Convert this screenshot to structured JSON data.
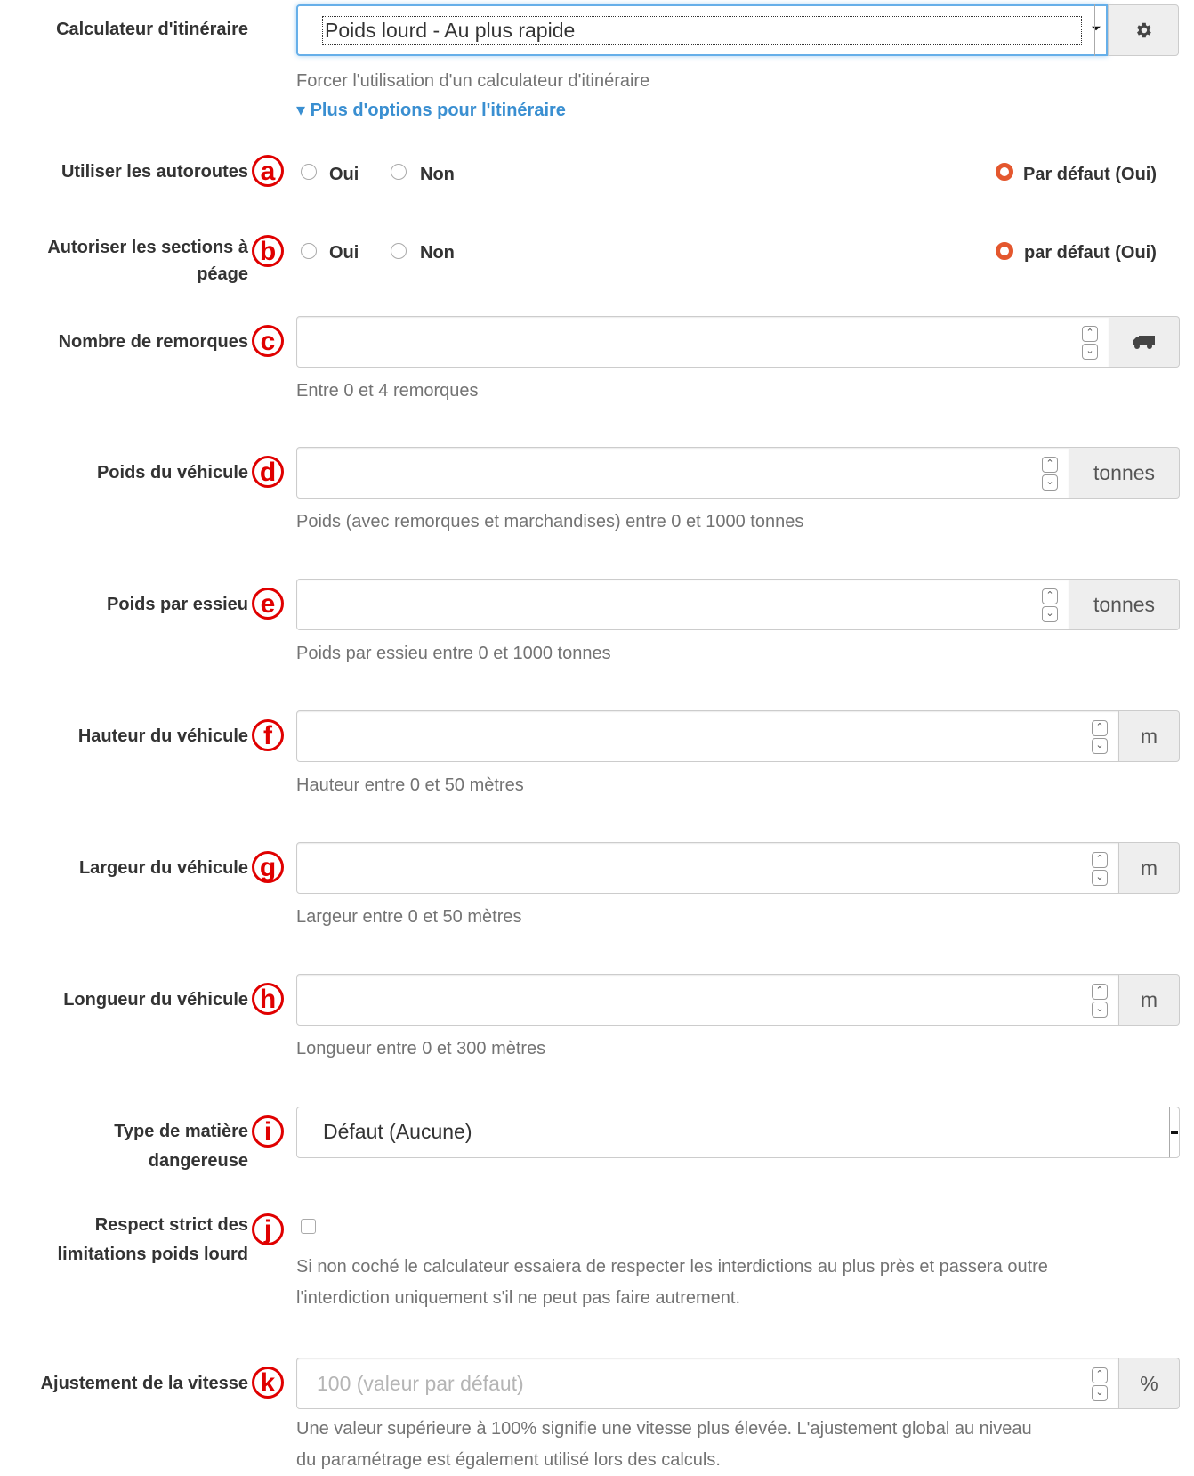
{
  "router": {
    "label": "Calculateur d'itinéraire",
    "selected": "Poids lourd - Au plus rapide",
    "help": "Forcer l'utilisation d'un calculateur d'itinéraire",
    "more_options": "▾ Plus d'options pour l'itinéraire"
  },
  "highways": {
    "label": "Utiliser les autoroutes",
    "badge": "a",
    "yes": "Oui",
    "no": "Non",
    "default": "Par défaut (Oui)"
  },
  "tolls": {
    "label_line1": "Autoriser les sections à",
    "label_line2": "péage",
    "badge": "b",
    "yes": "Oui",
    "no": "Non",
    "default": "par défaut (Oui)"
  },
  "trailers": {
    "label": "Nombre de remorques",
    "badge": "c",
    "help": "Entre 0 et 4 remorques"
  },
  "weight": {
    "label": "Poids du véhicule",
    "badge": "d",
    "unit": "tonnes",
    "help": "Poids (avec remorques et marchandises) entre 0 et 1000 tonnes"
  },
  "axle": {
    "label": "Poids par essieu",
    "badge": "e",
    "unit": "tonnes",
    "help": "Poids par essieu entre 0 et 1000 tonnes"
  },
  "height": {
    "label": "Hauteur du véhicule",
    "badge": "f",
    "unit": "m",
    "help": "Hauteur entre 0 et 50 mètres"
  },
  "width": {
    "label": "Largeur du véhicule",
    "badge": "g",
    "unit": "m",
    "help": "Largeur entre 0 et 50 mètres"
  },
  "length": {
    "label": "Longueur du véhicule",
    "badge": "h",
    "unit": "m",
    "help": "Longueur entre 0 et 300 mètres"
  },
  "hazmat": {
    "label_line1": "Type de matière",
    "label_line2": "dangereuse",
    "badge": "i",
    "selected": "Défaut (Aucune)"
  },
  "strict": {
    "label_line1": "Respect strict des",
    "label_line2": "limitations poids lourd",
    "badge": "j",
    "help_line1": "Si non coché le calculateur essaiera de respecter les interdictions au plus près et passera outre",
    "help_line2": "l'interdiction uniquement s'il ne peut pas faire autrement."
  },
  "speed": {
    "label": "Ajustement de la vitesse",
    "badge": "k",
    "placeholder": "100 (valeur par défaut)",
    "unit": "%",
    "help_line1": "Une valeur supérieure à 100% signifie une vitesse plus élevée. L'ajustement global au niveau",
    "help_line2": "du paramétrage est également utilisé lors des calculs."
  },
  "icons": {
    "settings": "gear-icon",
    "truck": "truck-icon",
    "spinner_up": "chevron-up-icon",
    "spinner_down": "chevron-down-icon"
  },
  "colors": {
    "accent": "#e4572e",
    "link": "#3a8fd1",
    "badge": "#e00000"
  }
}
